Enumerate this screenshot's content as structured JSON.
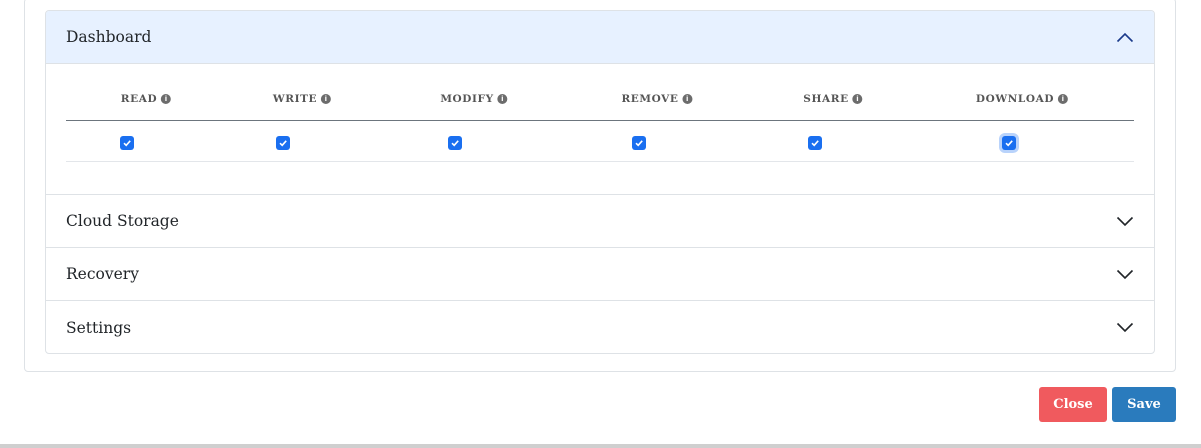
{
  "accordion": {
    "sections": [
      {
        "title": "Dashboard",
        "expanded": true
      },
      {
        "title": "Cloud Storage",
        "expanded": false
      },
      {
        "title": "Recovery",
        "expanded": false
      },
      {
        "title": "Settings",
        "expanded": false
      }
    ]
  },
  "permissions": {
    "columns": [
      "READ",
      "WRITE",
      "MODIFY",
      "REMOVE",
      "SHARE",
      "DOWNLOAD"
    ],
    "checked": [
      true,
      true,
      true,
      true,
      true,
      true
    ],
    "focused_column": "DOWNLOAD"
  },
  "footer": {
    "close_label": "Close",
    "save_label": "Save"
  },
  "colors": {
    "accent": "#1a6ff0",
    "active_header_bg": "#e7f1ff",
    "close_button": "#f05a5e",
    "save_button": "#2a7bbd"
  },
  "icons": {
    "info": "info-icon",
    "expanded": "chevron-up-icon",
    "collapsed": "chevron-down-icon",
    "checkbox": "checkmark-icon"
  }
}
